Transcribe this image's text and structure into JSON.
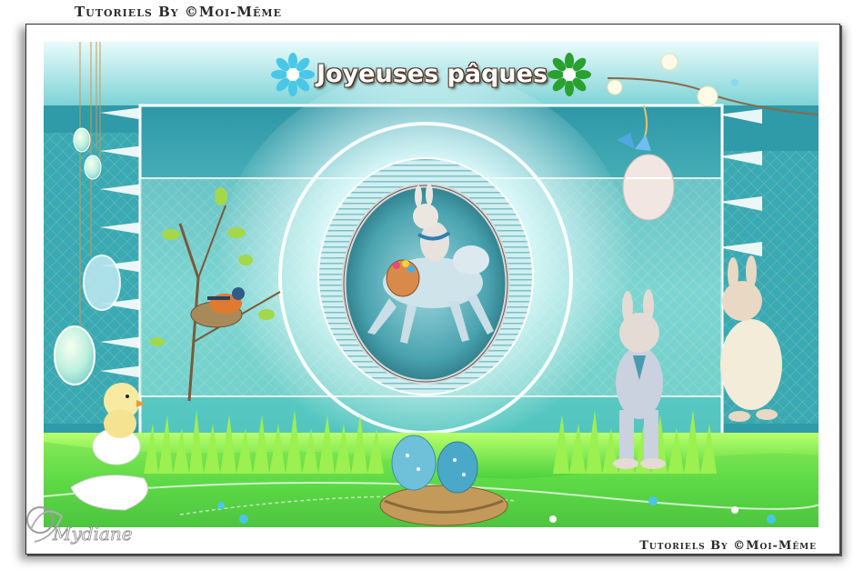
{
  "captions": {
    "top": "Tutoriels By ©Moi-Même",
    "bottom": "Tutoriels By ©Moi-Même"
  },
  "title": "Joyeuses pâques",
  "signature": "Mydiane",
  "colors": {
    "teal": "#2f9aa8",
    "aqua": "#6fd3d6",
    "grass": "#3cc83a",
    "grass_light": "#9ef24c",
    "flower_blue": "#49c7e6",
    "flower_green": "#2aa12f",
    "title_outline": "#4a3020"
  },
  "icons": [
    "flower-left-icon",
    "flower-right-icon"
  ]
}
